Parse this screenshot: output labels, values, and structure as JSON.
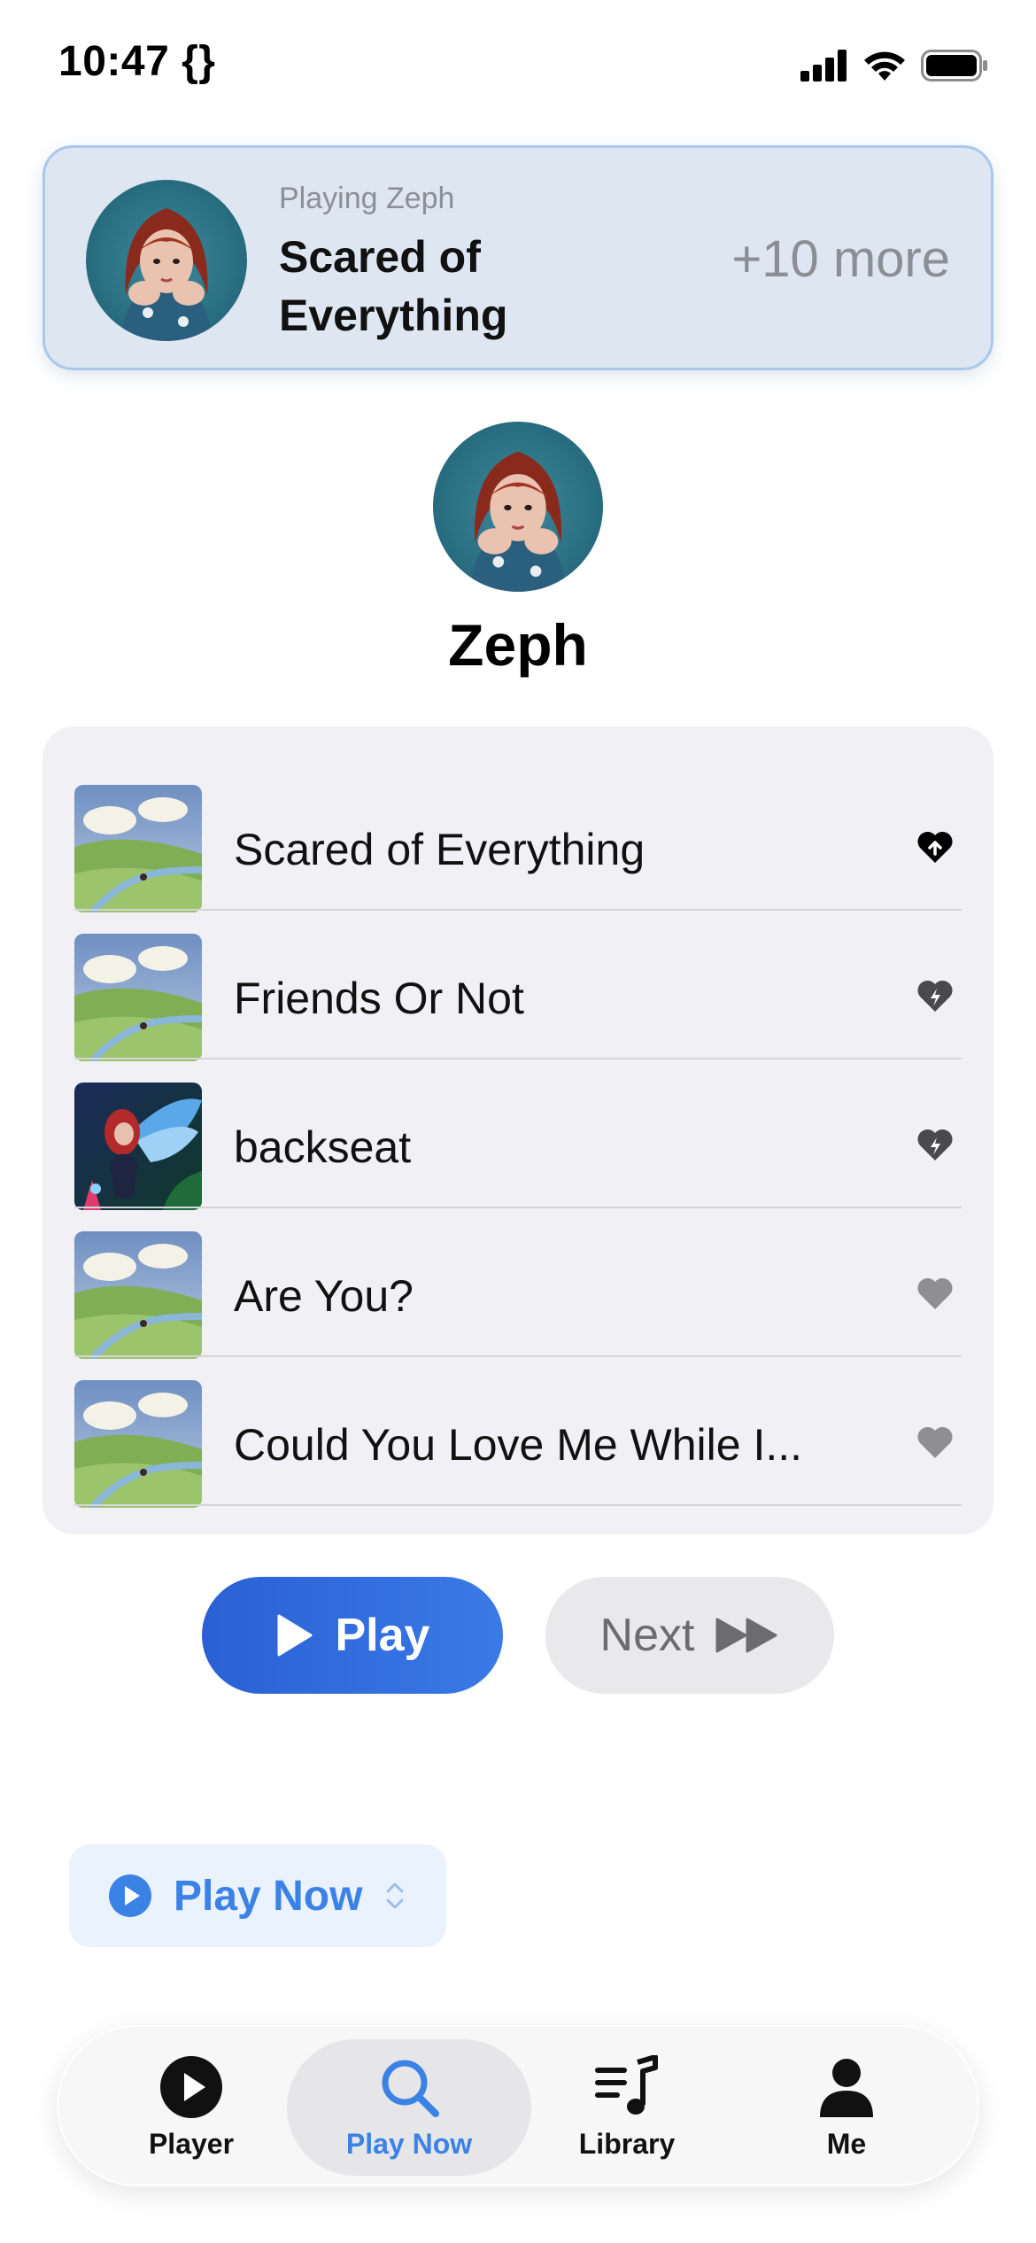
{
  "status_bar": {
    "time": "10:47 {}"
  },
  "banner": {
    "subtitle": "Playing Zeph",
    "title": "Scared of Everything",
    "more": "+10 more"
  },
  "artist": {
    "name": "Zeph"
  },
  "songs": [
    {
      "title": "Scared of Everything",
      "icon": "heart-upload-icon",
      "art": "meadow"
    },
    {
      "title": "Friends Or Not",
      "icon": "heart-bolt-icon",
      "art": "meadow"
    },
    {
      "title": "backseat",
      "icon": "heart-bolt-icon",
      "art": "angel"
    },
    {
      "title": "Are You?",
      "icon": "heart-icon",
      "art": "meadow"
    },
    {
      "title": "Could You Love Me While I...",
      "icon": "heart-icon",
      "art": "meadow"
    }
  ],
  "buttons": {
    "play": "Play",
    "next": "Next"
  },
  "chip": {
    "label": "Play Now"
  },
  "tabs": [
    {
      "label": "Player",
      "icon": "play-circle-icon",
      "active": false
    },
    {
      "label": "Play Now",
      "icon": "search-icon",
      "active": true
    },
    {
      "label": "Library",
      "icon": "library-music-icon",
      "active": false
    },
    {
      "label": "Me",
      "icon": "person-icon",
      "active": false
    }
  ],
  "colors": {
    "accent": "#3b82e6",
    "play_button": "#2a60d4",
    "banner_bg": "#dde6f1",
    "card_bg": "#f0f0f5"
  }
}
